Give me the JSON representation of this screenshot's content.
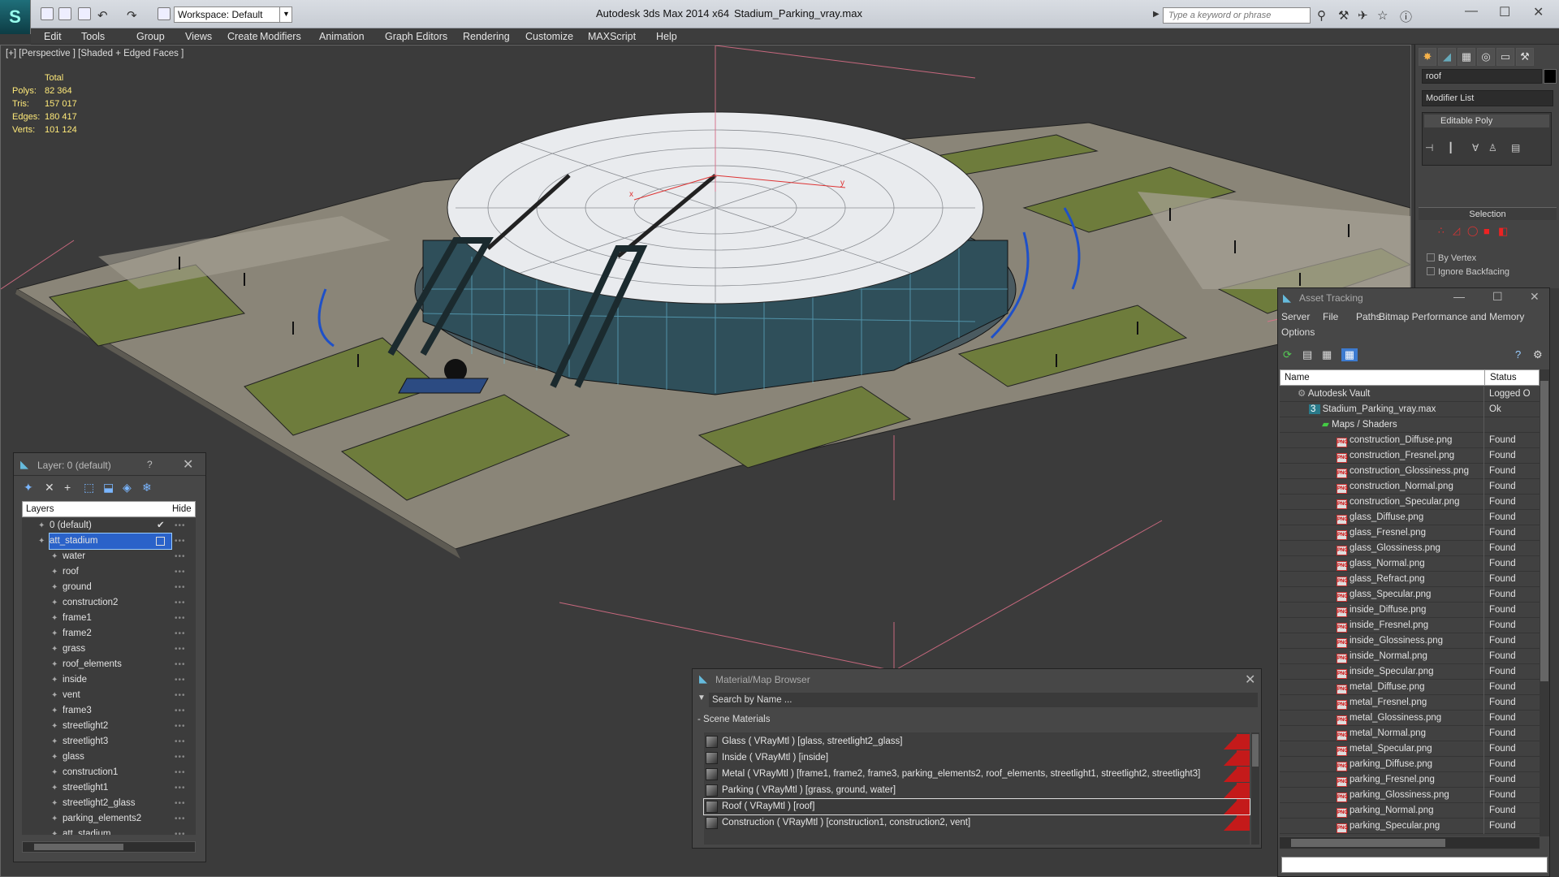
{
  "titlebar": {
    "app_title": "Autodesk 3ds Max  2014 x64",
    "file_title": "Stadium_Parking_vray.max",
    "workspace": "Workspace: Default",
    "search_placeholder": "Type a keyword or phrase"
  },
  "menu": [
    "Edit",
    "Tools",
    "Group",
    "Views",
    "Create",
    "Modifiers",
    "Animation",
    "Graph Editors",
    "Rendering",
    "Customize",
    "MAXScript",
    "Help"
  ],
  "viewport": {
    "label": "[+] [Perspective ] [Shaded + Edged Faces ]",
    "stats": {
      "header": "Total",
      "rows": [
        {
          "label": "Polys:",
          "value": "82 364"
        },
        {
          "label": "Tris:",
          "value": "157 017"
        },
        {
          "label": "Edges:",
          "value": "180 417"
        },
        {
          "label": "Verts:",
          "value": "101 124"
        }
      ]
    }
  },
  "command_panel": {
    "object_name": "roof",
    "modifier_list": "Modifier List",
    "stack_item": "Editable Poly",
    "selection_header": "Selection",
    "checkboxes": [
      "By Vertex",
      "Ignore Backfacing"
    ]
  },
  "layer_panel": {
    "title": "Layer: 0 (default)",
    "help": "?",
    "col_layers": "Layers",
    "col_hide": "Hide",
    "rows": [
      {
        "name": "0 (default)",
        "level": 0
      },
      {
        "name": "att_stadium",
        "level": 0,
        "selected": true
      },
      {
        "name": "water",
        "level": 1
      },
      {
        "name": "roof",
        "level": 1
      },
      {
        "name": "ground",
        "level": 1
      },
      {
        "name": "construction2",
        "level": 1
      },
      {
        "name": "frame1",
        "level": 1
      },
      {
        "name": "frame2",
        "level": 1
      },
      {
        "name": "grass",
        "level": 1
      },
      {
        "name": "roof_elements",
        "level": 1
      },
      {
        "name": "inside",
        "level": 1
      },
      {
        "name": "vent",
        "level": 1
      },
      {
        "name": "frame3",
        "level": 1
      },
      {
        "name": "streetlight2",
        "level": 1
      },
      {
        "name": "streetlight3",
        "level": 1
      },
      {
        "name": "glass",
        "level": 1
      },
      {
        "name": "construction1",
        "level": 1
      },
      {
        "name": "streetlight1",
        "level": 1
      },
      {
        "name": "streetlight2_glass",
        "level": 1
      },
      {
        "name": "parking_elements2",
        "level": 1
      },
      {
        "name": "att_stadium",
        "level": 1
      }
    ]
  },
  "asset_tracking": {
    "title": "Asset Tracking",
    "menu": [
      "Server",
      "File",
      "Paths",
      "Bitmap Performance and Memory",
      "Options"
    ],
    "col_name": "Name",
    "col_status": "Status",
    "rows": [
      {
        "name": "Autodesk Vault",
        "status": "Logged O",
        "level": 1,
        "kind": "vault"
      },
      {
        "name": "Stadium_Parking_vray.max",
        "status": "Ok",
        "level": 2,
        "kind": "max"
      },
      {
        "name": "Maps / Shaders",
        "status": "",
        "level": 3,
        "kind": "folder"
      },
      {
        "name": "construction_Diffuse.png",
        "status": "Found",
        "level": 4,
        "kind": "png"
      },
      {
        "name": "construction_Fresnel.png",
        "status": "Found",
        "level": 4,
        "kind": "png"
      },
      {
        "name": "construction_Glossiness.png",
        "status": "Found",
        "level": 4,
        "kind": "png"
      },
      {
        "name": "construction_Normal.png",
        "status": "Found",
        "level": 4,
        "kind": "png"
      },
      {
        "name": "construction_Specular.png",
        "status": "Found",
        "level": 4,
        "kind": "png"
      },
      {
        "name": "glass_Diffuse.png",
        "status": "Found",
        "level": 4,
        "kind": "png"
      },
      {
        "name": "glass_Fresnel.png",
        "status": "Found",
        "level": 4,
        "kind": "png"
      },
      {
        "name": "glass_Glossiness.png",
        "status": "Found",
        "level": 4,
        "kind": "png"
      },
      {
        "name": "glass_Normal.png",
        "status": "Found",
        "level": 4,
        "kind": "png"
      },
      {
        "name": "glass_Refract.png",
        "status": "Found",
        "level": 4,
        "kind": "png"
      },
      {
        "name": "glass_Specular.png",
        "status": "Found",
        "level": 4,
        "kind": "png"
      },
      {
        "name": "inside_Diffuse.png",
        "status": "Found",
        "level": 4,
        "kind": "png"
      },
      {
        "name": "inside_Fresnel.png",
        "status": "Found",
        "level": 4,
        "kind": "png"
      },
      {
        "name": "inside_Glossiness.png",
        "status": "Found",
        "level": 4,
        "kind": "png"
      },
      {
        "name": "inside_Normal.png",
        "status": "Found",
        "level": 4,
        "kind": "png"
      },
      {
        "name": "inside_Specular.png",
        "status": "Found",
        "level": 4,
        "kind": "png"
      },
      {
        "name": "metal_Diffuse.png",
        "status": "Found",
        "level": 4,
        "kind": "png"
      },
      {
        "name": "metal_Fresnel.png",
        "status": "Found",
        "level": 4,
        "kind": "png"
      },
      {
        "name": "metal_Glossiness.png",
        "status": "Found",
        "level": 4,
        "kind": "png"
      },
      {
        "name": "metal_Normal.png",
        "status": "Found",
        "level": 4,
        "kind": "png"
      },
      {
        "name": "metal_Specular.png",
        "status": "Found",
        "level": 4,
        "kind": "png"
      },
      {
        "name": "parking_Diffuse.png",
        "status": "Found",
        "level": 4,
        "kind": "png"
      },
      {
        "name": "parking_Fresnel.png",
        "status": "Found",
        "level": 4,
        "kind": "png"
      },
      {
        "name": "parking_Glossiness.png",
        "status": "Found",
        "level": 4,
        "kind": "png"
      },
      {
        "name": "parking_Normal.png",
        "status": "Found",
        "level": 4,
        "kind": "png"
      },
      {
        "name": "parking_Specular.png",
        "status": "Found",
        "level": 4,
        "kind": "png"
      }
    ]
  },
  "material_browser": {
    "title": "Material/Map Browser",
    "search_placeholder": "Search by Name ...",
    "section": "- Scene Materials",
    "rows": [
      {
        "name": "Glass  ( VRayMtl ) [glass, streetlight2_glass]"
      },
      {
        "name": "Inside  ( VRayMtl ) [inside]"
      },
      {
        "name": "Metal  ( VRayMtl ) [frame1, frame2, frame3, parking_elements2, roof_elements, streetlight1, streetlight2, streetlight3]"
      },
      {
        "name": "Parking  ( VRayMtl ) [grass, ground, water]"
      },
      {
        "name": "Roof  ( VRayMtl ) [roof]",
        "selected": true
      },
      {
        "name": "Construction  ( VRayMtl ) [construction1, construction2, vent]"
      }
    ]
  },
  "colors": {
    "viewport_bg": "#3b3b3b",
    "accent_blue": "#1e50c8",
    "stats_yellow": "#ffea7a",
    "material_flag": "#c41a1a"
  }
}
